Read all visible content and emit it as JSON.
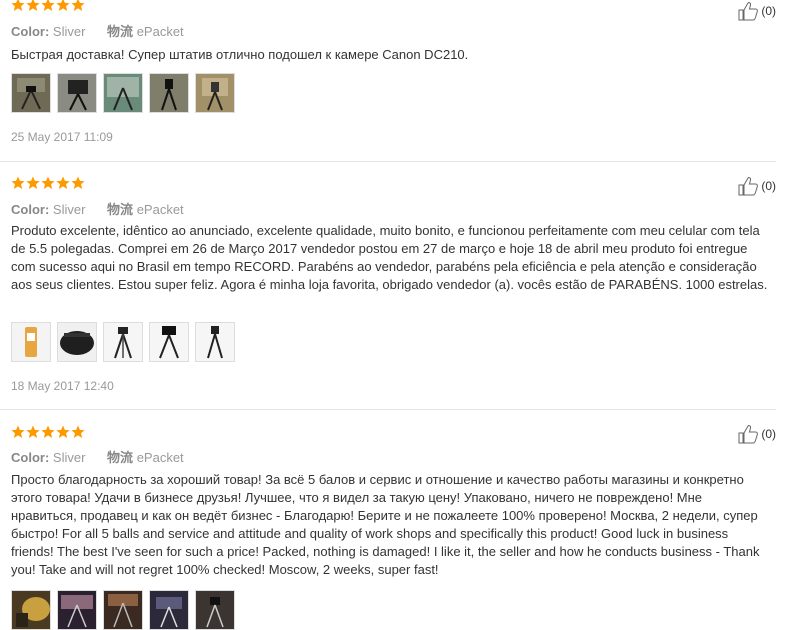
{
  "reviews": [
    {
      "rating": 5,
      "color_label": "Color:",
      "color_value": "Sliver",
      "shipping_label": "物流",
      "shipping_value": "ePacket",
      "likes": "(0)",
      "text": "Быстрая доставка! Супер штатив отлично подошел к камере Canon DC210.",
      "images": [
        "review-photo-tripod-1",
        "review-photo-tripod-2",
        "review-photo-tripod-3",
        "review-photo-tripod-4",
        "review-photo-tripod-5"
      ],
      "date": "25 May 2017 11:09"
    },
    {
      "rating": 5,
      "color_label": "Color:",
      "color_value": "Sliver",
      "shipping_label": "物流",
      "shipping_value": "ePacket",
      "likes": "(0)",
      "text": "Produto excelente, idêntico ao anunciado, excelente qualidade, muito bonito, e funcionou perfeitamente com meu celular com tela de 5.5 polegadas. Comprei em 26 de Março 2017 vendedor postou em 27 de março e hoje 18 de abril meu produto foi entregue com sucesso aqui no Brasil em tempo RECORD. Parabéns ao vendedor, parabéns pela eficiência e pela atenção e consideração aos seus clientes. Estou super feliz. Agora é minha loja favorita, obrigado vendedor (a). vocês estão de PARABÉNS. 1000 estrelas.",
      "images": [
        "review-photo-package",
        "review-photo-bag",
        "review-photo-tripod-a",
        "review-photo-tripod-b",
        "review-photo-tripod-c"
      ],
      "date": "18 May 2017 12:40"
    },
    {
      "rating": 5,
      "color_label": "Color:",
      "color_value": "Sliver",
      "shipping_label": "物流",
      "shipping_value": "ePacket",
      "likes": "(0)",
      "text": "Просто благодарность за хороший товар! За всё 5 балов и сервис и отношение и качество работы магазины и конкретно этого товара! Удачи в бизнесе друзья! Лучшее, что я видел за такую цену! Упаковано, ничего не повреждено! Мне нравиться, продавец и как он ведёт бизнес - Благодарю! Берите и не пожалеете 100% проверено! Москва, 2 недели, супер быстро! For all 5 balls and service and attitude and quality of work shops and specifically this product! Good luck in business friends! The best I've seen for such a price! Packed, nothing is damaged! I like it, the seller and how he conducts business - Thank you! Take and will not regret 100% checked! Moscow, 2 weeks, super fast!",
      "images": [
        "review-photo-room-1",
        "review-photo-room-2",
        "review-photo-room-3",
        "review-photo-room-4",
        "review-photo-room-5"
      ],
      "date": ""
    }
  ],
  "colors": {
    "star": "#ff9900",
    "divider": "#e6e6e6",
    "meta": "#999999"
  }
}
